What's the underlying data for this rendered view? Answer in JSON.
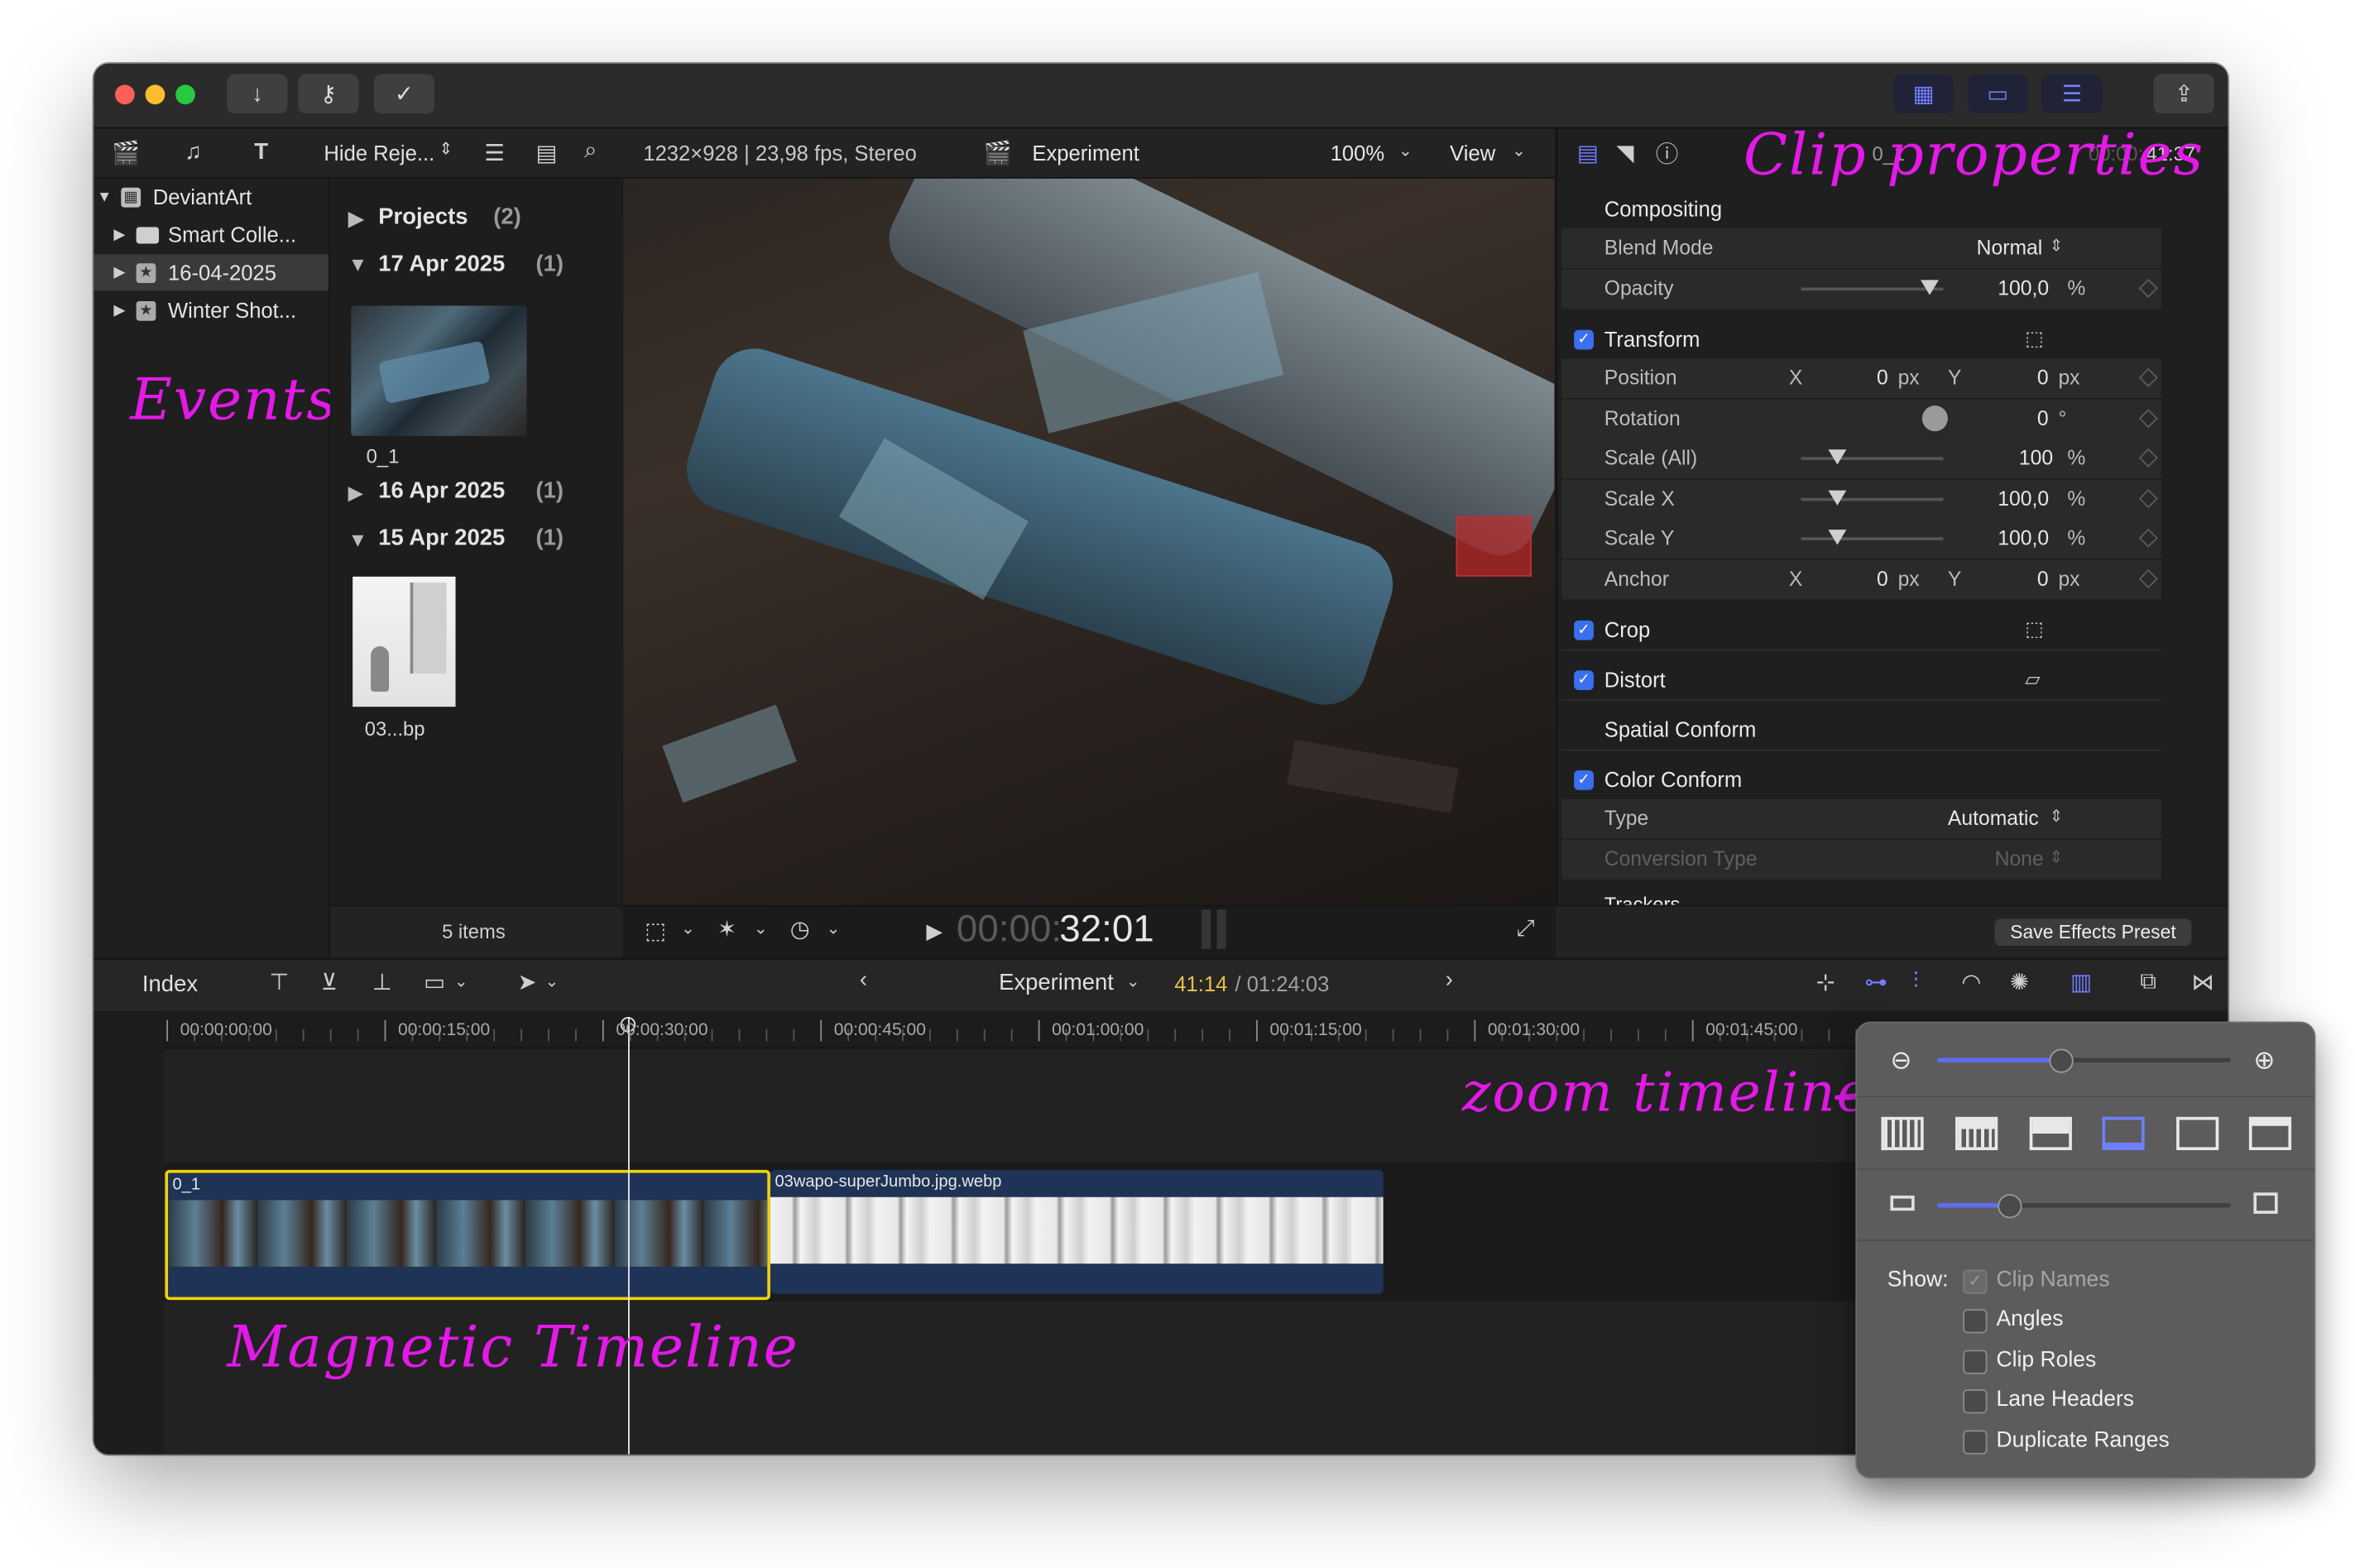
{
  "window": {
    "title_icons": [
      "download-icon",
      "key-icon",
      "check-circle-icon"
    ],
    "right_icons": [
      "browser-grid-icon",
      "timeline-icon",
      "inspector-icon",
      "share-icon"
    ]
  },
  "browser": {
    "filter": "Hide Reje...",
    "library": {
      "name": "DeviantArt",
      "items": [
        "Smart Colle...",
        "16-04-2025",
        "Winter Shot..."
      ]
    },
    "groups": [
      {
        "label": "Projects",
        "count": "(2)"
      },
      {
        "label": "17 Apr 2025",
        "count": "(1)"
      },
      {
        "label": "16 Apr 2025",
        "count": "(1)"
      },
      {
        "label": "15 Apr 2025",
        "count": "(1)"
      }
    ],
    "clips": [
      "0_1",
      "03...bp"
    ],
    "items_count": "5 items"
  },
  "viewer": {
    "info": "1232×928 | 23,98 fps, Stereo",
    "project": "Experiment",
    "zoom": "100%",
    "view": "View",
    "timecode_dim": "00:00:",
    "timecode": "32:01"
  },
  "inspector": {
    "clip_label": "0_1",
    "time_dim": "00:00:",
    "time": "41:37",
    "compositing": "Compositing",
    "blend_mode_label": "Blend Mode",
    "blend_mode_value": "Normal",
    "opacity_label": "Opacity",
    "opacity_value": "100,0",
    "opacity_unit": "%",
    "transform": "Transform",
    "position_label": "Position",
    "x": "X",
    "y": "Y",
    "zero": "0",
    "px": "px",
    "rotation_label": "Rotation",
    "rotation_unit": "°",
    "scale_all_label": "Scale (All)",
    "scale_all_value": "100",
    "scale_x_label": "Scale X",
    "scale_x_value": "100,0",
    "scale_y_label": "Scale Y",
    "scale_y_value": "100,0",
    "anchor_label": "Anchor",
    "crop": "Crop",
    "distort": "Distort",
    "spatial_conform": "Spatial Conform",
    "color_conform": "Color Conform",
    "type_label": "Type",
    "type_value": "Automatic",
    "conversion_label": "Conversion Type",
    "conversion_value": "None",
    "trackers": "Trackers",
    "save_preset": "Save Effects Preset",
    "opacity_level": 0.9,
    "scale_level": 0.25
  },
  "timeline": {
    "index": "Index",
    "project": "Experiment",
    "time_current": "41:14",
    "time_total": "/ 01:24:03",
    "ruler": [
      "00:00:00:00",
      "00:00:15:00",
      "00:00:30:00",
      "00:00:45:00",
      "00:01:00:00",
      "00:01:15:00",
      "00:01:30:00",
      "00:01:45:00"
    ],
    "clip1": "0_1",
    "clip2": "03wapo-superJumbo.jpg.webp"
  },
  "popover": {
    "zoom_level": 0.42,
    "height_level": 0.24,
    "show_label": "Show:",
    "options": [
      "Clip Names",
      "Angles",
      "Clip Roles",
      "Lane Headers",
      "Duplicate Ranges"
    ],
    "clip_names_checked": true
  },
  "annotations": {
    "events": "Events",
    "clip_properties": "Clip properties",
    "zoom_timeline": "zoom timeline",
    "magnetic_timeline": "Magnetic Timeline"
  },
  "colors": {
    "accent": "#6f7dff",
    "annotation": "#e419e8",
    "clip_selected": "#f0d20a",
    "timecode_yellow": "#e6c14a"
  }
}
